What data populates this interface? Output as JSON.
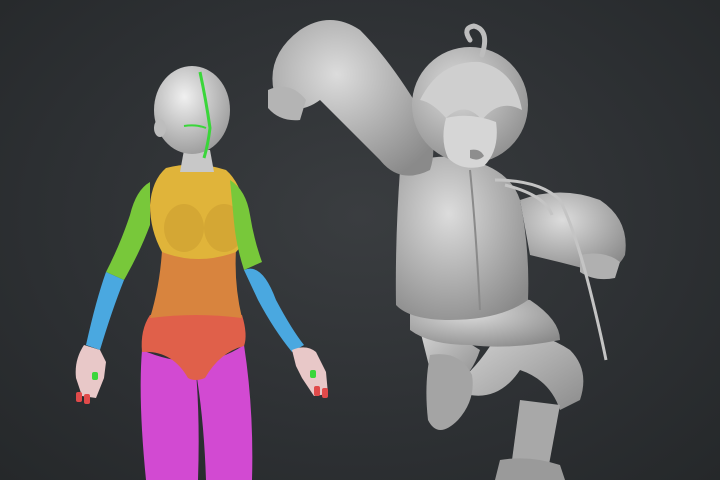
{
  "scene": {
    "background": "#2f3235",
    "figures": [
      {
        "id": "base-mesh-figure",
        "polygroup_colors": {
          "head": "#d9d9d9",
          "face_line": "#3ad63a",
          "torso_upper": "#e0b43a",
          "torso_mid": "#d8843e",
          "pelvis": "#e0604a",
          "legs": "#d24ad2",
          "arm_upper": "#78c83a",
          "arm_lower": "#4aa8e0",
          "hands": "#e8c8c8",
          "fingertips": "#e04a4a",
          "finger_green": "#3ad63a"
        }
      },
      {
        "id": "sculpted-jumping-character",
        "material_color": "#bdbdbd"
      }
    ]
  }
}
